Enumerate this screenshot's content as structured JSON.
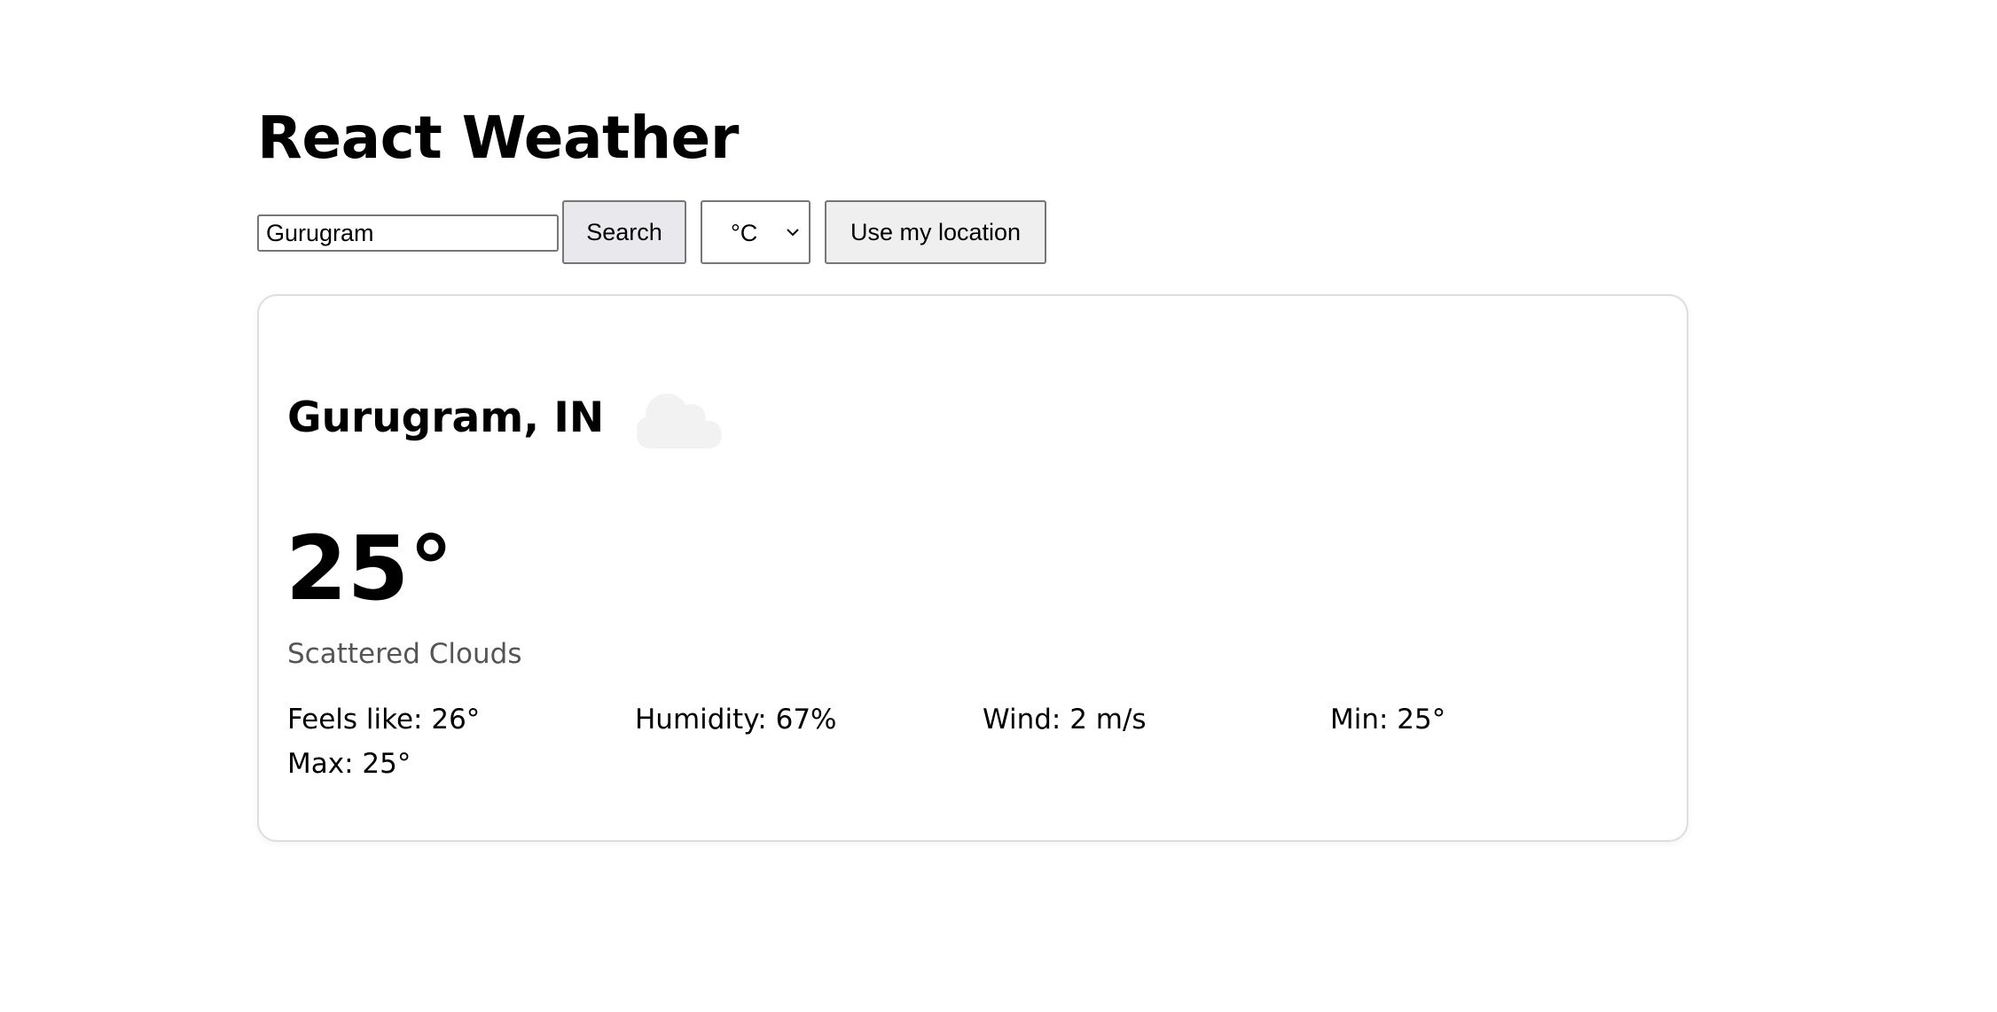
{
  "app": {
    "title": "React Weather"
  },
  "controls": {
    "search_input_value": "Gurugram",
    "search_button_label": "Search",
    "unit_selected": "°C",
    "location_button_label": "Use my location"
  },
  "weather": {
    "location": "Gurugram, IN",
    "icon": "cloud-icon",
    "temperature": "25°",
    "description": "Scattered Clouds",
    "stats": {
      "feels_like": "Feels like: 26°",
      "humidity": "Humidity: 67%",
      "wind": "Wind: 2 m/s",
      "min": "Min: 25°",
      "max": "Max: 25°"
    }
  },
  "colors": {
    "card_border": "#dedede",
    "description_text": "#555555",
    "cloud_fill": "#f2f2f2"
  }
}
